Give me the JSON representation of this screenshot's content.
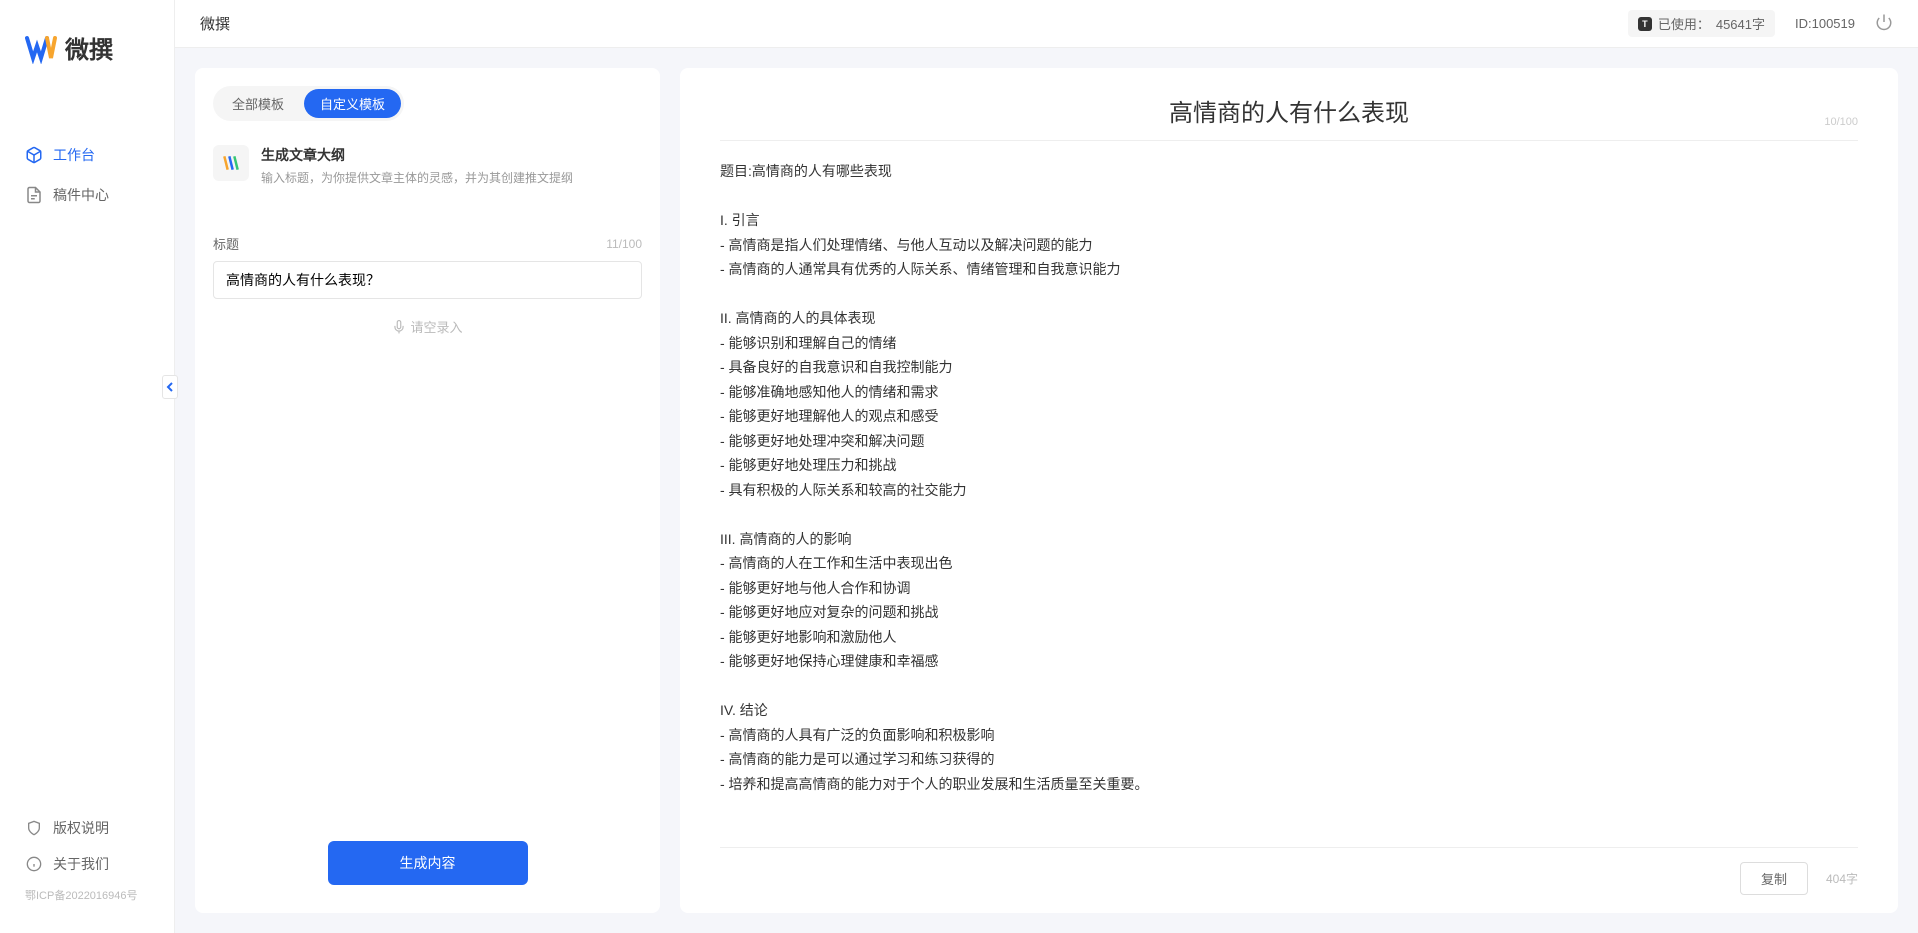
{
  "app": {
    "name": "微撰",
    "header_title": "微撰",
    "usage_label": "已使用：",
    "usage_value": "45641字",
    "user_id_label": "ID:100519"
  },
  "sidebar": {
    "nav": [
      {
        "label": "工作台",
        "icon": "box",
        "active": true
      },
      {
        "label": "稿件中心",
        "icon": "doc",
        "active": false
      }
    ],
    "footer": [
      {
        "label": "版权说明",
        "icon": "shield"
      },
      {
        "label": "关于我们",
        "icon": "info"
      }
    ],
    "icp": "鄂ICP备2022016946号"
  },
  "left_panel": {
    "tabs": [
      {
        "label": "全部模板",
        "active": false
      },
      {
        "label": "自定义模板",
        "active": true
      }
    ],
    "template": {
      "title": "生成文章大纲",
      "desc": "输入标题，为你提供文章主体的灵感，并为其创建推文提纲"
    },
    "form": {
      "label": "标题",
      "counter": "11/100",
      "value": "高情商的人有什么表现？",
      "voice_hint": "请空录入"
    },
    "generate_btn": "生成内容"
  },
  "right_panel": {
    "title": "高情商的人有什么表现",
    "title_counter": "10/100",
    "body": "题目:高情商的人有哪些表现\n\nI. 引言\n- 高情商是指人们处理情绪、与他人互动以及解决问题的能力\n- 高情商的人通常具有优秀的人际关系、情绪管理和自我意识能力\n\nII. 高情商的人的具体表现\n- 能够识别和理解自己的情绪\n- 具备良好的自我意识和自我控制能力\n- 能够准确地感知他人的情绪和需求\n- 能够更好地理解他人的观点和感受\n- 能够更好地处理冲突和解决问题\n- 能够更好地处理压力和挑战\n- 具有积极的人际关系和较高的社交能力\n\nIII. 高情商的人的影响\n- 高情商的人在工作和生活中表现出色\n- 能够更好地与他人合作和协调\n- 能够更好地应对复杂的问题和挑战\n- 能够更好地影响和激励他人\n- 能够更好地保持心理健康和幸福感\n\nIV. 结论\n- 高情商的人具有广泛的负面影响和积极影响\n- 高情商的能力是可以通过学习和练习获得的\n- 培养和提高高情商的能力对于个人的职业发展和生活质量至关重要。",
    "copy_btn": "复制",
    "char_count": "404字"
  }
}
